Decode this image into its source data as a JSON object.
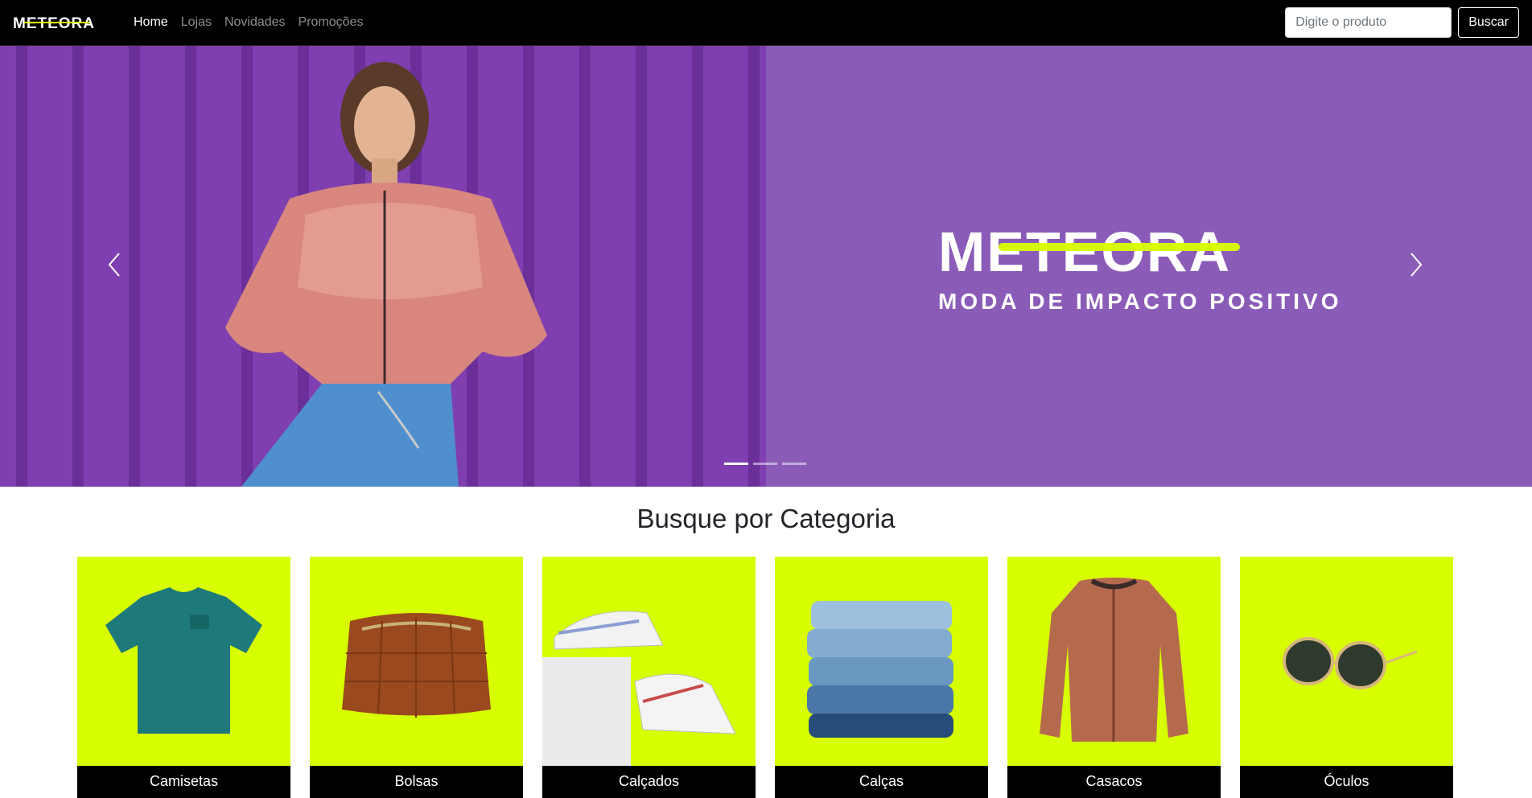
{
  "brand": {
    "name": "METEORA",
    "accent": "#d8ff00",
    "purple": "#8a5cb8"
  },
  "nav": {
    "items": [
      {
        "label": "Home",
        "active": true
      },
      {
        "label": "Lojas",
        "active": false
      },
      {
        "label": "Novidades",
        "active": false
      },
      {
        "label": "Promoções",
        "active": false
      }
    ]
  },
  "search": {
    "placeholder": "Digite o produto",
    "button_label": "Buscar"
  },
  "hero": {
    "brand": "METEORA",
    "tagline": "MODA DE IMPACTO POSITIVO",
    "prev_icon": "chevron-left-icon",
    "next_icon": "chevron-right-icon",
    "slides": 3,
    "active_slide": 1
  },
  "categories": {
    "title": "Busque por Categoria",
    "items": [
      {
        "label": "Camisetas",
        "icon": "tshirt-icon"
      },
      {
        "label": "Bolsas",
        "icon": "bag-icon"
      },
      {
        "label": "Calçados",
        "icon": "sneakers-icon"
      },
      {
        "label": "Calças",
        "icon": "jeans-icon"
      },
      {
        "label": "Casacos",
        "icon": "jacket-icon"
      },
      {
        "label": "Óculos",
        "icon": "sunglasses-icon"
      }
    ]
  }
}
